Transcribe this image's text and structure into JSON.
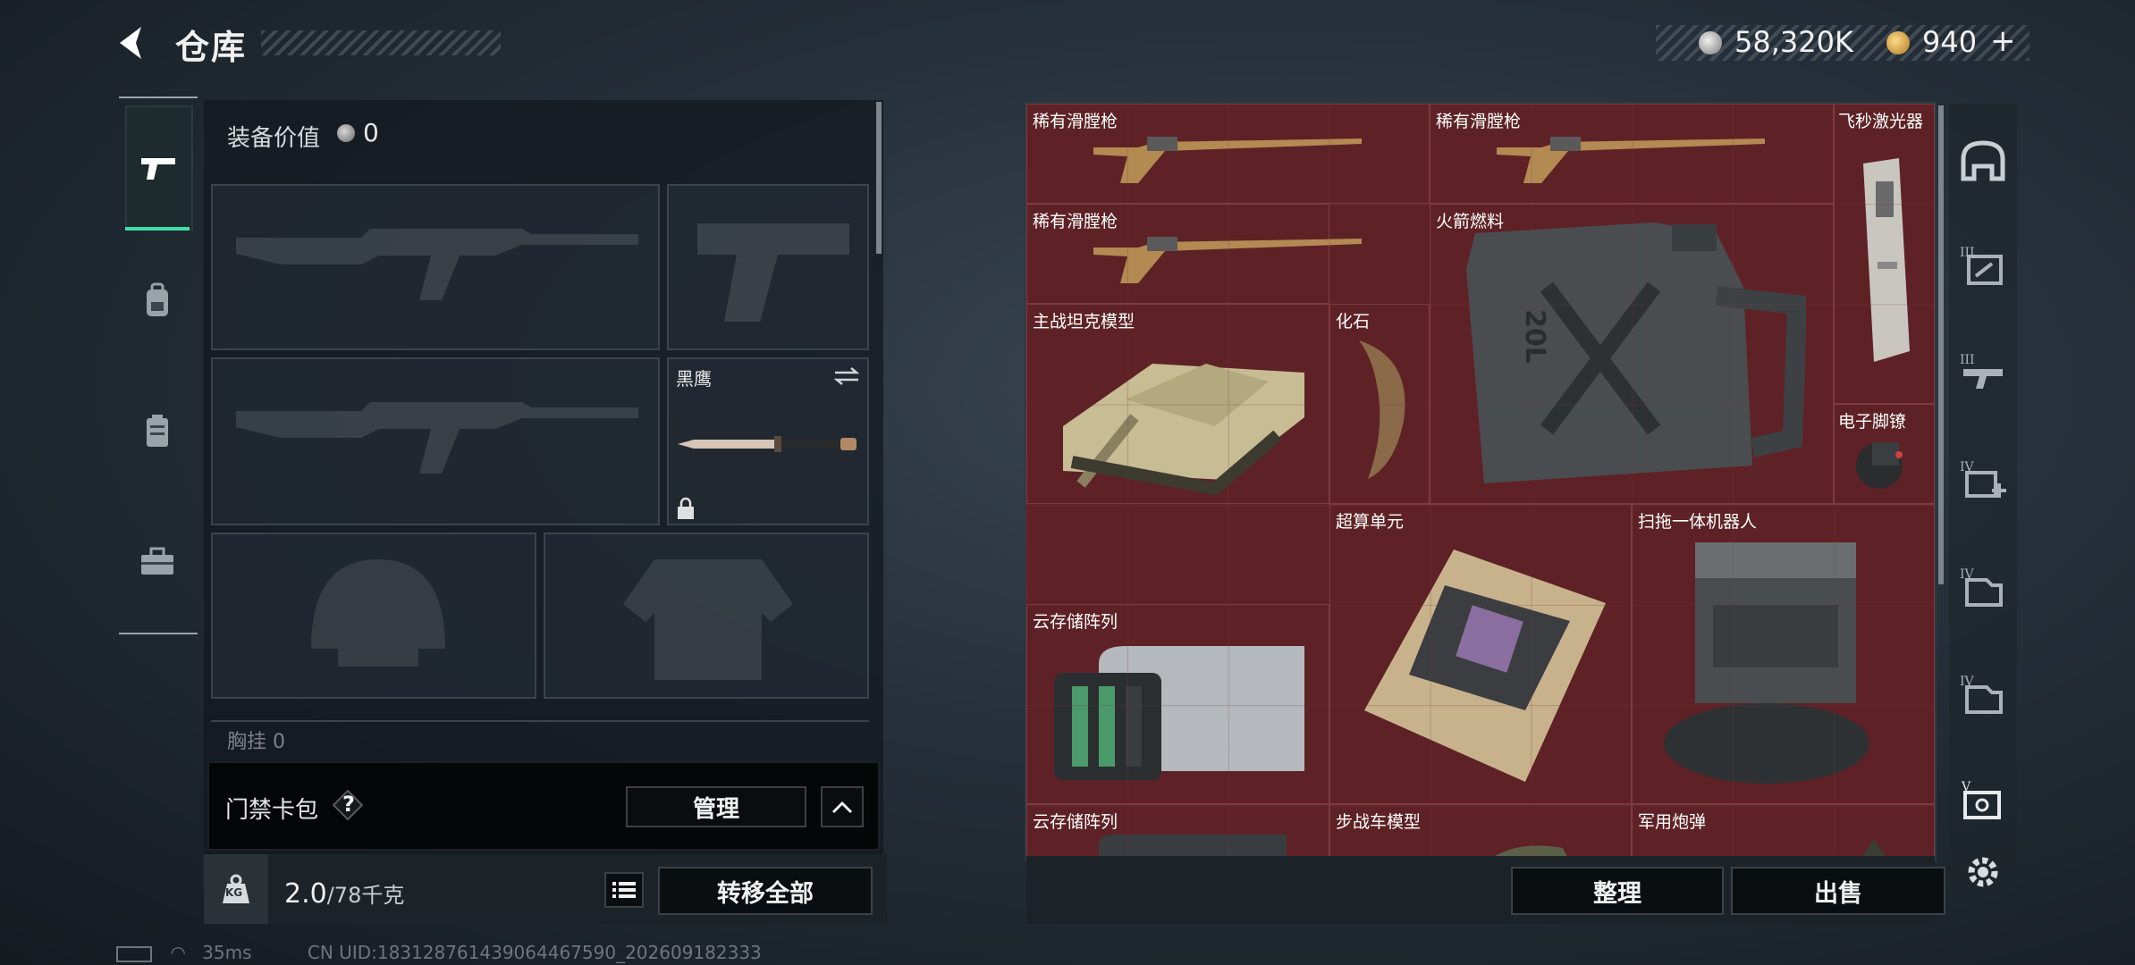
{
  "header": {
    "title": "仓库",
    "currencies": [
      {
        "icon": "silver-coin-icon",
        "value": "58,320K"
      },
      {
        "icon": "gold-coin-icon",
        "value": "940"
      }
    ],
    "add_symbol": "+"
  },
  "left_tabs": [
    {
      "name": "pistol-icon",
      "selected": true
    },
    {
      "name": "backpack-icon",
      "selected": false
    },
    {
      "name": "vest-icon",
      "selected": false
    },
    {
      "name": "toolbox-icon",
      "selected": false
    }
  ],
  "equipment": {
    "value_label": "装备价值",
    "value": "0",
    "melee_label": "黑鹰",
    "chest_label": "胸挂",
    "chest_value": "0"
  },
  "keycard": {
    "label": "门禁卡包",
    "help": "?",
    "manage": "管理"
  },
  "weight": {
    "current": "2.0",
    "max": "/78千克",
    "unit_icon": "KG",
    "transfer_all": "转移全部"
  },
  "warehouse": {
    "items": [
      {
        "label": "稀有滑膛枪",
        "icon": "flintlock-rifle"
      },
      {
        "label": "稀有滑膛枪",
        "icon": "flintlock-rifle"
      },
      {
        "label": "飞秒激光器",
        "icon": "laser-device"
      },
      {
        "label": "稀有滑膛枪",
        "icon": "flintlock-rifle"
      },
      {
        "label": "火箭燃料",
        "icon": "jerry-can",
        "can_text": "20L"
      },
      {
        "label": "主战坦克模型",
        "icon": "tank-model"
      },
      {
        "label": "化石",
        "icon": "claw-fossil"
      },
      {
        "label": "电子脚镣",
        "icon": "ankle-monitor"
      },
      {
        "label": "超算单元",
        "icon": "compute-board"
      },
      {
        "label": "扫拖一体机器人",
        "icon": "robot-vacuum"
      },
      {
        "label": "云存储阵列",
        "icon": "storage-array"
      },
      {
        "label": "云存储阵列",
        "icon": "storage-array"
      },
      {
        "label": "步战车模型",
        "icon": "ifv-model"
      },
      {
        "label": "军用炮弹",
        "icon": "artillery-shell"
      }
    ],
    "sort": "整理",
    "sell": "出售"
  },
  "right_tabs": [
    {
      "name": "helmet-tab-icon"
    },
    {
      "name": "tier-iii-case-icon",
      "tier": "III"
    },
    {
      "name": "tier-iii-gun-icon",
      "tier": "III"
    },
    {
      "name": "tier-iv-medkit-icon",
      "tier": "IV"
    },
    {
      "name": "tier-iv-case-icon",
      "tier": "IV"
    },
    {
      "name": "tier-iv-case-icon-2",
      "tier": "IV"
    },
    {
      "name": "tier-v-safe-icon",
      "tier": "V"
    },
    {
      "name": "settings-icon"
    }
  ],
  "status": {
    "ping": "35ms",
    "uid": "CN UID:18312876143906446759​0_202609182333"
  }
}
